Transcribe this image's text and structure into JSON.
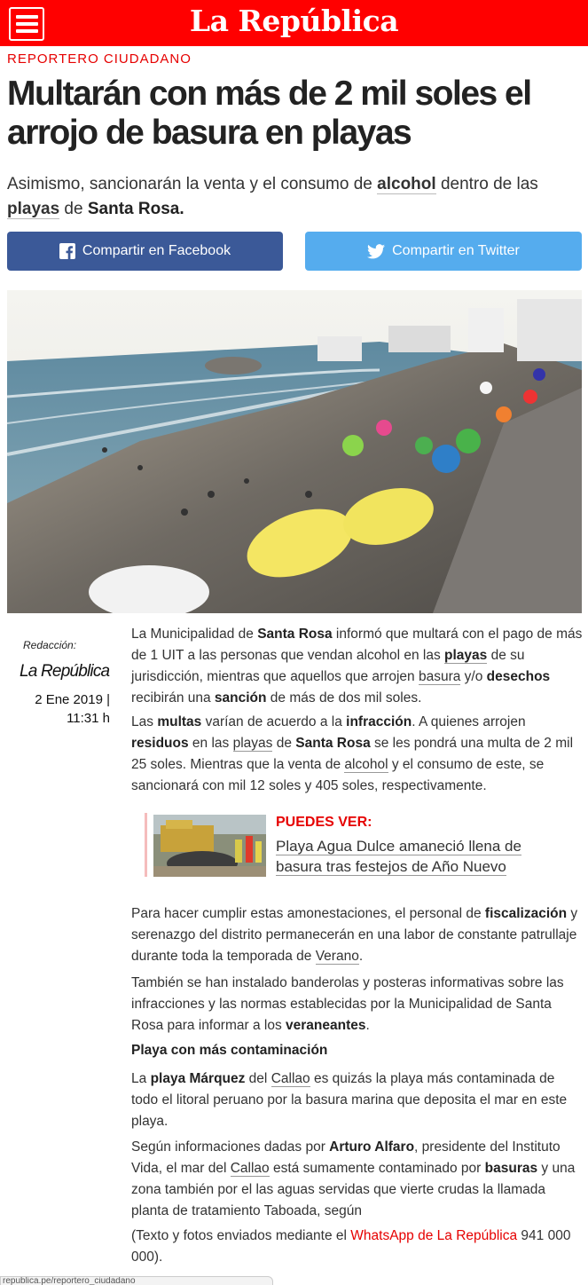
{
  "header": {
    "brand": "La República",
    "menu_icon": "hamburger-icon",
    "brand_color": "#ff0000"
  },
  "article": {
    "section": "REPORTERO CIUDADANO",
    "headline": "Multarán con más de 2 mil soles el arrojo de basura en playas",
    "dek": {
      "t1": "Asimismo, sancionarán la venta y el consumo de ",
      "k1": "alcohol",
      "t2": " dentro de las ",
      "k2": "playas",
      "t3": " de ",
      "k3": "Santa Rosa."
    },
    "share": {
      "facebook": "Compartir en Facebook",
      "twitter": "Compartir en Twitter",
      "facebook_color": "#3b5998",
      "twitter_color": "#55acee"
    },
    "byline": {
      "label": "Redacción:",
      "brand": "La República",
      "date": "2 Ene 2019 | 11:31 h"
    },
    "p1": {
      "a": "La Municipalidad de ",
      "b": "Santa Rosa",
      "c": " informó que multará con el pago de más de 1 UIT a las personas que vendan alcohol en las ",
      "d": "playas",
      "e": " de su jurisdicción, mientras que aquellos que arrojen ",
      "f": "basura",
      "g": " y/o ",
      "h": "desechos",
      "i": " recibirán una ",
      "j": "sanción",
      "k": " de más de dos mil soles."
    },
    "p2": {
      "a": "Las ",
      "b": "multas",
      "c": " varían de acuerdo a la ",
      "d": "infracción",
      "e": ". A quienes arrojen ",
      "f": "residuos",
      "g": " en las ",
      "h": "playas",
      "i": " de ",
      "j": "Santa Rosa",
      "k": " se les pondrá una multa de 2 mil  25 soles. Mientras que la venta de ",
      "l": "alcohol",
      "m": " y el consumo de este, se sancionará con mil 12 soles y 405 soles, respectivamente."
    },
    "related": {
      "kicker": "PUEDES VER:",
      "title": "Playa Agua Dulce amaneció llena de basura tras festejos de Año Nuevo"
    },
    "p3": {
      "a": "Para hacer cumplir estas amonestaciones, el personal de ",
      "b": "fiscalización",
      "c": " y serenazgo del distrito permanecerán en una labor de constante patrullaje durante toda la temporada de ",
      "d": "Verano",
      "e": "."
    },
    "p4": {
      "a": "También se han instalado banderolas y posteras informativas sobre las infracciones y las normas establecidas por la Municipalidad de Santa Rosa para informar a los ",
      "b": "veraneantes",
      "c": "."
    },
    "subhead": "Playa con más contaminación",
    "p5": {
      "a": "La ",
      "b": "playa Márquez",
      "c": " del ",
      "d": "Callao",
      "e": " es quizás la playa más contaminada de todo el litoral peruano por la basura marina  que deposita el mar en este playa."
    },
    "p6": {
      "a": "Según informaciones dadas por ",
      "b": "Arturo Alfaro",
      "c": ", presidente del Instituto Vida, el mar del ",
      "d": "Callao",
      "e": " está sumamente contaminado por ",
      "f": "basuras",
      "g": " y una zona también por el las aguas servidas que vierte crudas la llamada planta de tratamiento Taboada, según"
    },
    "p7": {
      "a": "(Texto y fotos enviados mediante el ",
      "b": "WhatsApp de La República",
      "c": " 941 000 000)."
    }
  },
  "status_url": "republica.pe/reportero_ciudadano"
}
